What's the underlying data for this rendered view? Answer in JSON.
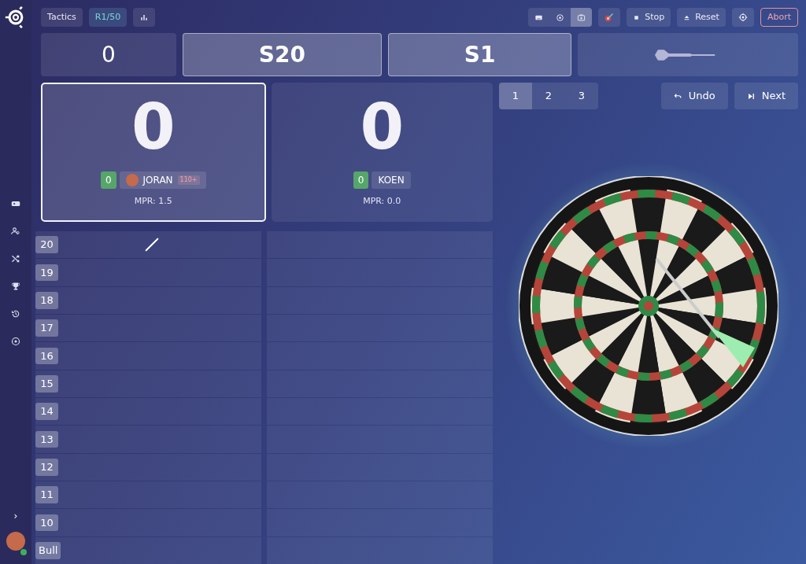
{
  "sidebar": {
    "expand": "›",
    "user": {
      "online": true
    }
  },
  "toolbar": {
    "left": [
      {
        "kind": "text",
        "label": "Tactics"
      },
      {
        "kind": "badge",
        "label": "R1/50"
      },
      {
        "kind": "icon"
      }
    ],
    "view_modes": [
      {
        "selected": false
      },
      {
        "selected": false
      },
      {
        "selected": true
      }
    ],
    "right": [
      {
        "kind": "icon"
      },
      {
        "kind": "text",
        "label": "Stop"
      },
      {
        "kind": "text",
        "label": "Reset"
      },
      {
        "kind": "icon"
      },
      {
        "kind": "danger",
        "label": "Abort"
      }
    ]
  },
  "turn": {
    "points": "0",
    "darts": [
      {
        "kind": "hit",
        "label": "S20"
      },
      {
        "kind": "hit",
        "label": "S1"
      },
      {
        "kind": "pending"
      }
    ]
  },
  "players": [
    {
      "score": "0",
      "marks": "0",
      "name": "JORAN",
      "avatar": true,
      "tag": "110+",
      "mpr": "MPR: 1.5",
      "selected": true
    },
    {
      "score": "0",
      "marks": "0",
      "name": "KOEN",
      "avatar": false,
      "mpr": "MPR: 0.0",
      "selected": false
    }
  ],
  "throw_tabs": [
    {
      "label": "1",
      "selected": true
    },
    {
      "label": "2",
      "selected": false
    },
    {
      "label": "3",
      "selected": false
    }
  ],
  "actions": [
    {
      "label": "Undo"
    },
    {
      "label": "Next"
    }
  ],
  "board": [
    {
      "label": "20",
      "marks": [
        {
          "kind": "single"
        },
        {
          "kind": "none"
        }
      ]
    },
    {
      "label": "19",
      "marks": [
        {
          "kind": "none"
        },
        {
          "kind": "none"
        }
      ]
    },
    {
      "label": "18",
      "marks": [
        {
          "kind": "none"
        },
        {
          "kind": "none"
        }
      ]
    },
    {
      "label": "17",
      "marks": [
        {
          "kind": "none"
        },
        {
          "kind": "none"
        }
      ]
    },
    {
      "label": "16",
      "marks": [
        {
          "kind": "none"
        },
        {
          "kind": "none"
        }
      ]
    },
    {
      "label": "15",
      "marks": [
        {
          "kind": "none"
        },
        {
          "kind": "none"
        }
      ]
    },
    {
      "label": "14",
      "marks": [
        {
          "kind": "none"
        },
        {
          "kind": "none"
        }
      ]
    },
    {
      "label": "13",
      "marks": [
        {
          "kind": "none"
        },
        {
          "kind": "none"
        }
      ]
    },
    {
      "label": "12",
      "marks": [
        {
          "kind": "none"
        },
        {
          "kind": "none"
        }
      ]
    },
    {
      "label": "11",
      "marks": [
        {
          "kind": "none"
        },
        {
          "kind": "none"
        }
      ]
    },
    {
      "label": "10",
      "marks": [
        {
          "kind": "none"
        },
        {
          "kind": "none"
        }
      ]
    },
    {
      "label": "Bull",
      "marks": [
        {
          "kind": "none"
        },
        {
          "kind": "none"
        }
      ]
    }
  ]
}
